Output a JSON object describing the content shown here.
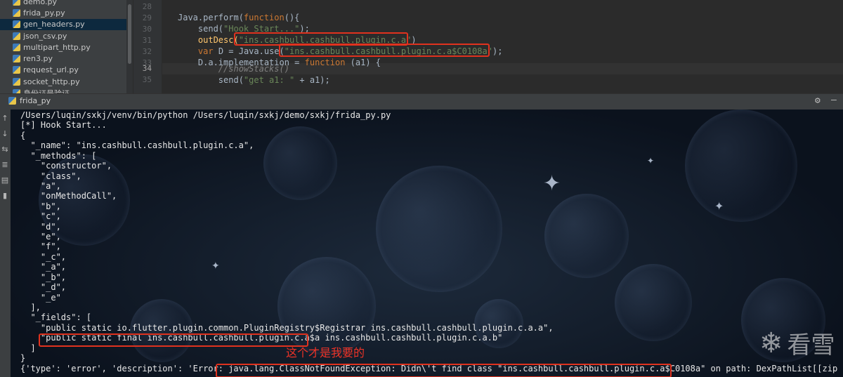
{
  "project_tree": {
    "files": [
      {
        "name": "demo.py",
        "selected": false
      },
      {
        "name": "frida_py.py",
        "selected": false
      },
      {
        "name": "gen_headers.py",
        "selected": true
      },
      {
        "name": "json_csv.py",
        "selected": false
      },
      {
        "name": "multipart_http.py",
        "selected": false
      },
      {
        "name": "ren3.py",
        "selected": false
      },
      {
        "name": "request_url.py",
        "selected": false
      },
      {
        "name": "socket_http.py",
        "selected": false
      },
      {
        "name": "身份证号验证",
        "selected": false
      }
    ]
  },
  "editor": {
    "line_numbers": [
      "28",
      "29",
      "30",
      "31",
      "32",
      "33",
      "34",
      "35"
    ],
    "current_line": "34",
    "lines": {
      "l29_a": "Java.perform(",
      "l29_b": "function",
      "l29_c": "(){",
      "l30_a": "    send(",
      "l30_b": "\"Hook Start...\"",
      "l30_c": ");",
      "l31_a": "    outDesc(",
      "l31_b": "\"ins.cashbull.cashbull.plugin.c.a\"",
      "l31_c": ")",
      "l32_a": "    ",
      "l32_b": "var",
      "l32_c": " D = Java.use(",
      "l32_d": "\"ins.cashbull.cashbull.plugin.c.a$C0108a\"",
      "l32_e": ");",
      "l33_a": "    D.a.implementation = ",
      "l33_b": "function",
      "l33_c": " (a1) {",
      "l34_a": "        //showStacks()",
      "l35_a": "        send(",
      "l35_b": "\"get a1: \"",
      "l35_c": " + a1);"
    }
  },
  "run_panel": {
    "tab_label": "frida_py",
    "icons": [
      "rerun-up-icon",
      "arrow-down-icon",
      "soft-wrap-icon",
      "scroll-to-end-icon",
      "print-icon",
      "trash-icon"
    ]
  },
  "console": {
    "lines": [
      "/Users/luqin/sxkj/venv/bin/python /Users/luqin/sxkj/demo/sxkj/frida_py.py",
      "[*] Hook Start...",
      "{",
      "  \"_name\": \"ins.cashbull.cashbull.plugin.c.a\",",
      "  \"_methods\": [",
      "    \"constructor\",",
      "    \"class\",",
      "    \"a\",",
      "    \"onMethodCall\",",
      "    \"b\",",
      "    \"c\",",
      "    \"d\",",
      "    \"e\",",
      "    \"f\",",
      "    \"_c\",",
      "    \"_a\",",
      "    \"_b\",",
      "    \"_d\",",
      "    \"_e\"",
      "  ],",
      "  \"_fields\": [",
      "    \"public static io.flutter.plugin.common.PluginRegistry$Registrar ins.cashbull.cashbull.plugin.c.a.a\",",
      "    \"public static final ins.cashbull.cashbull.plugin.c.a$a ins.cashbull.cashbull.plugin.c.a.b\"",
      "  ]",
      "}",
      "{'type': 'error', 'description': 'Error: java.lang.ClassNotFoundException: Didn\\'t find class \"ins.cashbull.cashbull.plugin.c.a$C0108a\" on path: DexPathList[[zip file \"/c"
    ],
    "annotation": "这个才是我要的"
  },
  "watermark": {
    "text": "看雪"
  }
}
